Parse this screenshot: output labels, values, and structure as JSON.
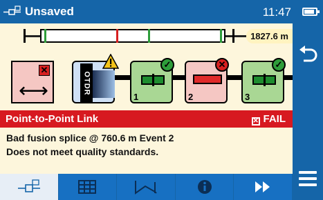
{
  "status_bar": {
    "title": "Unsaved",
    "time": "11:47",
    "app_icon": "link-mapper-icon",
    "battery_icon": "battery-icon"
  },
  "overview": {
    "total_length": "1827.6 m"
  },
  "link": {
    "launch_icon": "launch-cable-icon",
    "otdr_label": "OTDR",
    "events": [
      {
        "number": "1",
        "status": "pass",
        "type": "splice"
      },
      {
        "number": "2",
        "status": "fail",
        "type": "splice"
      },
      {
        "number": "3",
        "status": "pass",
        "type": "splice"
      }
    ]
  },
  "banner": {
    "title": "Point-to-Point Link",
    "result": "FAIL"
  },
  "message": {
    "line1": "Bad fusion splice @ 760.6 m Event 2",
    "line2": "Does not meet quality standards."
  },
  "tabs": [
    {
      "icon": "link-map-icon",
      "active": true
    },
    {
      "icon": "table-icon",
      "active": false
    },
    {
      "icon": "trace-icon",
      "active": false
    },
    {
      "icon": "info-icon",
      "active": false
    },
    {
      "icon": "fast-forward-icon",
      "active": false
    }
  ],
  "colors": {
    "brand_blue": "#1565a8",
    "fail_red": "#d71920",
    "pass_green": "#a9d794",
    "background": "#fdf6dc"
  }
}
